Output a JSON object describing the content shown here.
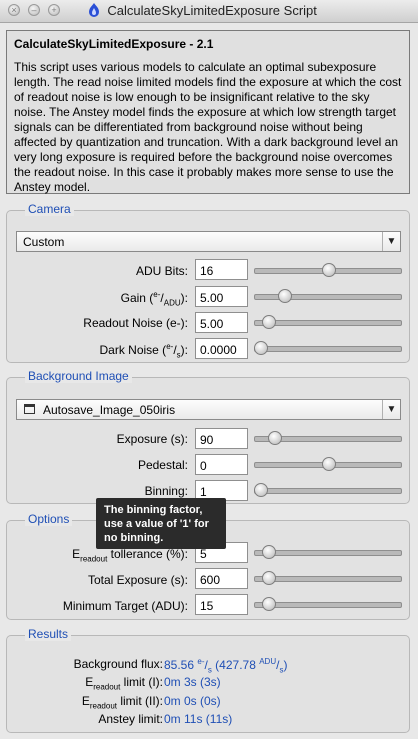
{
  "window": {
    "title": "CalculateSkyLimitedExposure Script",
    "close_glyph": "×",
    "minimize_glyph": "–",
    "zoom_glyph": "+"
  },
  "description": {
    "title": "CalculateSkyLimitedExposure - 2.1",
    "body": "This script uses various models to calculate an optimal subexposure length. The read noise limited models find the exposure at which the cost of readout noise is low enough to be insignificant relative to the sky noise. The Anstey model finds the exposure at which low strength target signals can be differentiated from background noise without being affected by quantization and truncation. With a dark background level an very long exposure is required before the background noise overcomes the readout noise. In this case it probably makes more sense to use the Anstey model."
  },
  "camera": {
    "title": "Camera",
    "preset": "Custom",
    "dropdown_glyph": "▼",
    "adu_bits": {
      "label": "ADU Bits:",
      "value": "16",
      "slider": 0.5
    },
    "gain": {
      "label_pre": "Gain (",
      "label_sup": "e-",
      "label_slash": "/",
      "label_sub": "ADU",
      "label_post": "):",
      "value": "5.00",
      "slider": 0.18
    },
    "readout_noise": {
      "label": "Readout Noise (e-):",
      "value": "5.00",
      "slider": 0.06
    },
    "dark_noise": {
      "label_pre": "Dark Noise (",
      "label_sup": "e-",
      "label_slash": "/",
      "label_sub": "s",
      "label_post": "):",
      "value": "0.0000",
      "slider": 0.0
    }
  },
  "background": {
    "title": "Background Image",
    "image": "Autosave_Image_050iris",
    "dropdown_glyph": "▼",
    "exposure": {
      "label": "Exposure (s):",
      "value": "90",
      "slider": 0.1
    },
    "pedestal": {
      "label": "Pedestal:",
      "value": "0",
      "slider": 0.5
    },
    "binning": {
      "label": "Binning:",
      "value": "1",
      "slider": 0.0
    }
  },
  "options": {
    "title": "Options",
    "tolerance": {
      "label_pre": "E",
      "label_sub": "readout",
      "label_post": " tollerance (%):",
      "value": "5",
      "slider": 0.06
    },
    "total_exposure": {
      "label": "Total Exposure (s):",
      "value": "600",
      "slider": 0.06
    },
    "minimum_target": {
      "label": "Minimum Target (ADU):",
      "value": "15",
      "slider": 0.06
    }
  },
  "results": {
    "title": "Results",
    "background_flux": {
      "label": "Background flux:",
      "value_pre": "85.56 ",
      "value_sup": "e-",
      "value_slash": "/",
      "value_sub": "s",
      "value_mid": " (427.78 ",
      "value_sup2": "ADU",
      "value_slash2": "/",
      "value_sub2": "s",
      "value_post": ")"
    },
    "limit_1": {
      "label_pre": "E",
      "label_sub": "readout",
      "label_post": " limit (I):",
      "value": "0m 3s (3s)"
    },
    "limit_2": {
      "label_pre": "E",
      "label_sub": "readout",
      "label_post": " limit (II):",
      "value": "0m 0s (0s)"
    },
    "anstey": {
      "label": "Anstey limit:",
      "value": "0m 11s (11s)"
    }
  },
  "tooltip": {
    "text": "The binning factor, use a value of '1' for no binning."
  },
  "colors": {
    "accent": "#1f4fb5",
    "tooltip_bg": "#2b2b2b"
  }
}
